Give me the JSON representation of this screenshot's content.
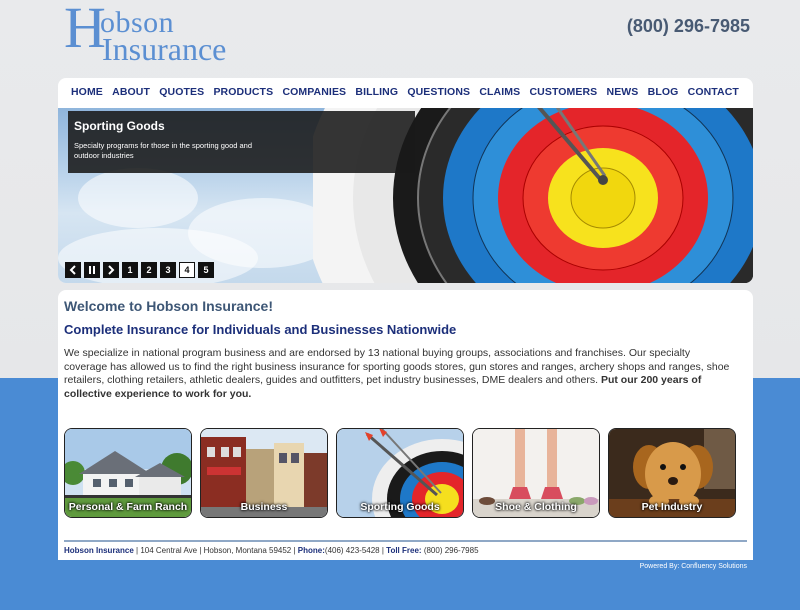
{
  "header": {
    "logo_initial": "H",
    "logo_word1": "obson",
    "logo_word2": "Insurance",
    "phone": "(800) 296-7985"
  },
  "nav": {
    "items": [
      "HOME",
      "ABOUT",
      "QUOTES",
      "PRODUCTS",
      "COMPANIES",
      "BILLING",
      "QUESTIONS",
      "CLAIMS",
      "CUSTOMERS",
      "NEWS",
      "BLOG",
      "CONTACT"
    ]
  },
  "slider": {
    "title": "Sporting Goods",
    "description": "Specialty programs for those in the sporting good and outdoor industries",
    "prev_icon": "chevron-left",
    "pause_icon": "pause",
    "next_icon": "chevron-right",
    "pages": [
      "1",
      "2",
      "3",
      "4",
      "5"
    ],
    "active_page": "4"
  },
  "main": {
    "welcome": "Welcome to Hobson Insurance!",
    "subhead": "Complete Insurance for Individuals and Businesses Nationwide",
    "intro": "We specialize in national program business and are endorsed by 13 national buying groups, associations and franchises. Our specialty coverage has allowed us to find the right business insurance for sporting goods stores, gun stores and ranges, archery shops and ranges, shoe retailers, clothing retailers, athletic dealers, guides and outfitters, pet industry businesses, DME dealers and others.",
    "intro_bold": "Put our 200 years of collective experience to work for you."
  },
  "tiles": [
    {
      "label": "Personal & Farm Ranch"
    },
    {
      "label": "Business"
    },
    {
      "label": "Sporting Goods"
    },
    {
      "label": "Shoe & Clothing"
    },
    {
      "label": "Pet Industry"
    }
  ],
  "footer": {
    "company": "Hobson Insurance",
    "address": "| 104 Central Ave | Hobson, Montana 59452 |",
    "phone_label": "Phone:",
    "phone": "(406) 423-5428 |",
    "tollfree_label": "Toll Free:",
    "tollfree": "(800) 296-7985",
    "powered": "Powered By: Confluency Solutions"
  },
  "colors": {
    "brand_blue": "#5b8fd2",
    "nav_navy": "#1c2f7a",
    "band_blue": "#4a8bd4"
  }
}
